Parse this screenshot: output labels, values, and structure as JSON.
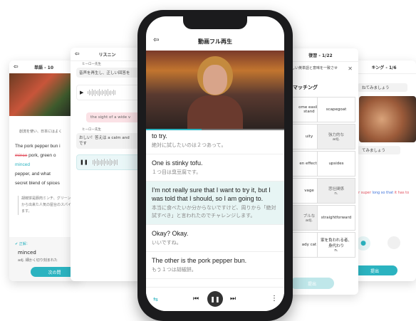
{
  "word_card": {
    "title": "単語 - 10",
    "context_text": "創流を使い、日本にはよく",
    "sentence_1": "The pork pepper bun i",
    "sentence_2_word": "mince",
    "sentence_2_rest": "pork, green o",
    "sentence_3_word": "minced",
    "sentence_4": "pepper, and what",
    "sentence_5": "secret blend of spices",
    "translation": "胡椒饼是豚肉ミンチ、グリーン\nから出来た人気の屋台のスパイ\nます。",
    "correct_label": "正解：",
    "answer_word": "minced",
    "answer_note": "adj. 細かく切り刻まれた",
    "next_button": "次の問"
  },
  "listening_card": {
    "title": "リスニン",
    "hero_tag_1": "ヒーロー先生",
    "prompt_1": "音声を再生し、正しい回答を",
    "answer_chip": "the sight of a wide v",
    "hero_tag_2": "ヒーロー先生",
    "prompt_2": "おしい！答えは a calm and\nです"
  },
  "phone": {
    "title": "動画フル再生",
    "lines": [
      {
        "en": "to try.",
        "jp": "絶対に試したいのは２つあって。"
      },
      {
        "en": "One is stinky tofu.",
        "jp": "１つ目は臭豆腐です。"
      },
      {
        "en": "I'm not really sure that I want to try it, but I was told that I should, so I am going to.",
        "jp": "本当に食べたいか分からないですけど、周りから「絶対試すべき」と言われたのでチャレンジします。"
      },
      {
        "en": "Okay? Okay.",
        "jp": "いいですね。"
      },
      {
        "en": "The other is the pork pepper bun.",
        "jp": "もう１つは胡椒餅。"
      }
    ]
  },
  "review_card": {
    "title": "復習 - 1/22",
    "instruction": "しい英単語と意味を一致させ",
    "section": "マッチング",
    "cells": [
      [
        "ome easily\nstand",
        "scapegoat"
      ],
      [
        "uity",
        "強力的な\nadj."
      ],
      [
        "en effects",
        "upsides"
      ],
      [
        "vage",
        "悲壮関係\nn."
      ],
      [
        "ブルな\nadj.",
        "straightforward"
      ],
      [
        "ady cat",
        "家を負われる者、\n身代わり\nn."
      ]
    ],
    "submit": "提出"
  },
  "speaking_card": {
    "title": "キング - 1/6",
    "chip_1": "ねてみましょう",
    "chip_2": "てみましょう",
    "result_red": "er super",
    "result_blue": "long so that",
    "result_red_2": "it has to",
    "submit": "提出"
  }
}
